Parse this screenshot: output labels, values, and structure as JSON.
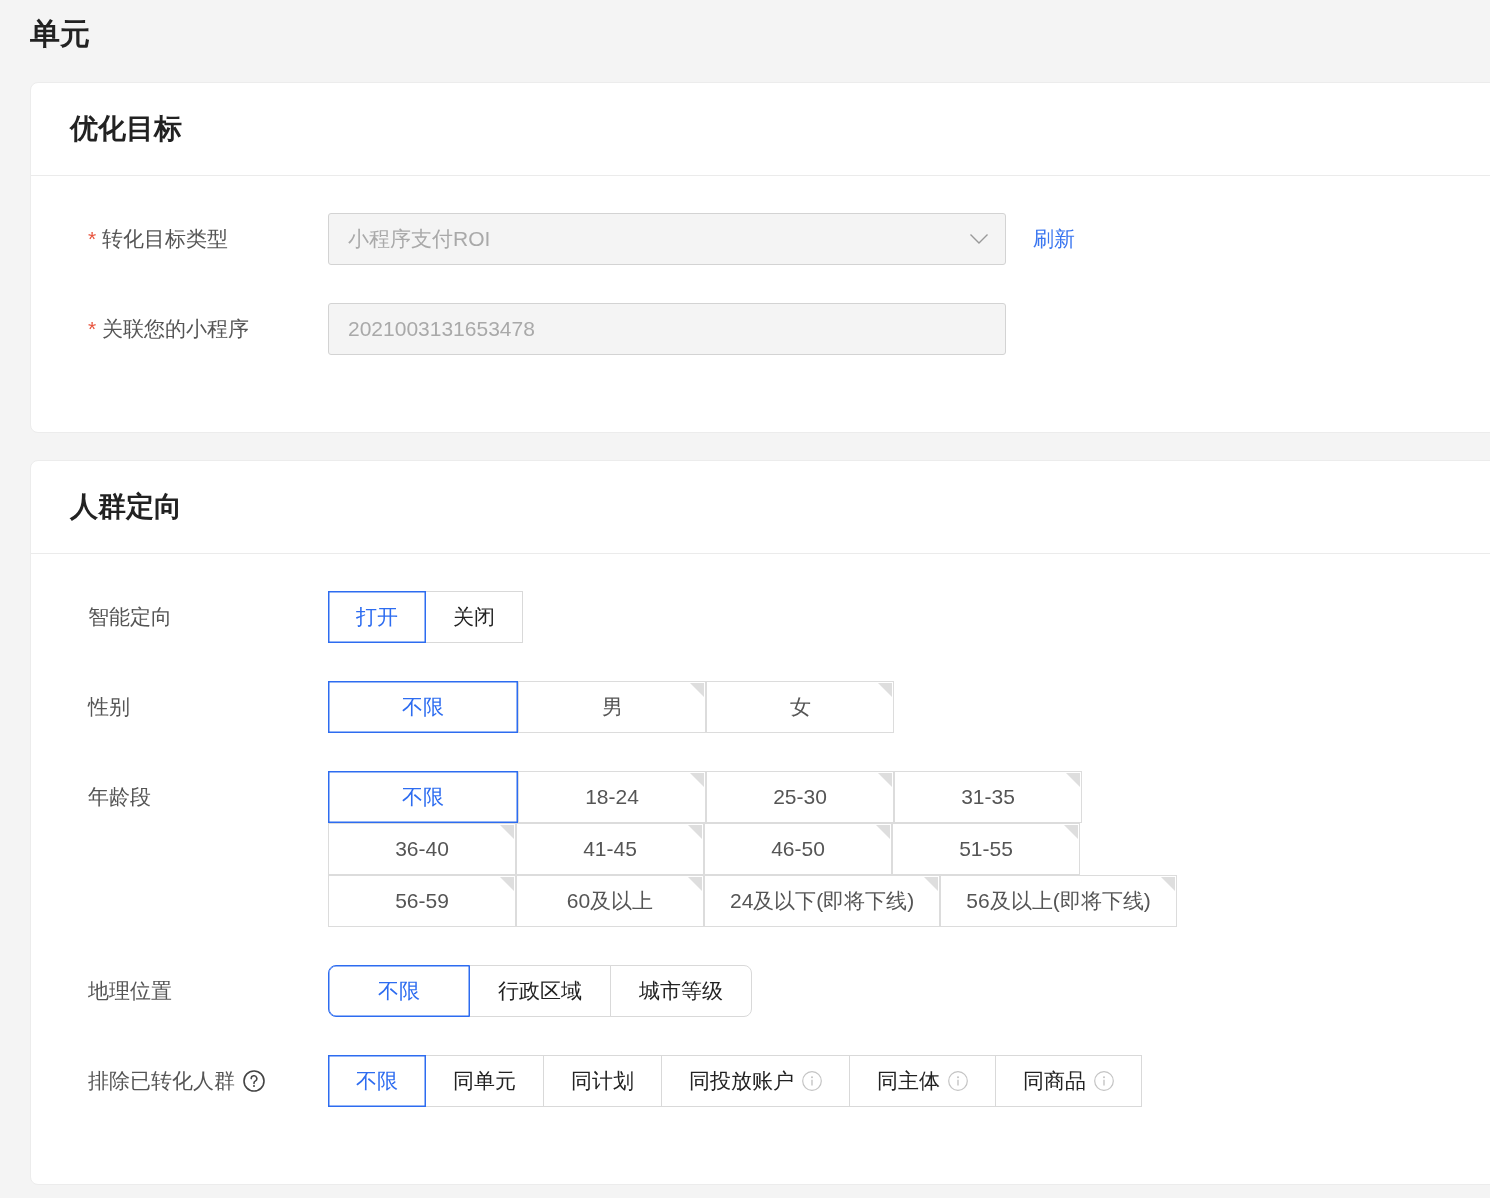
{
  "page_title": "单元",
  "sections": [
    {
      "title": "优化目标",
      "fields": [
        {
          "kind": "select",
          "required_mark": "*",
          "label": "转化目标类型",
          "value": "小程序支付ROI",
          "disabled": true,
          "link": "刷新"
        },
        {
          "kind": "input",
          "required_mark": "*",
          "label": "关联您的小程序",
          "value": "2021003131653478",
          "disabled": true
        }
      ]
    },
    {
      "title": "人群定向",
      "fields": [
        {
          "kind": "buttons",
          "label": "智能定向",
          "options": [
            {
              "label": "打开",
              "selected": true
            },
            {
              "label": "关闭",
              "selected": false
            }
          ]
        },
        {
          "kind": "tiles",
          "label": "性别",
          "options": [
            {
              "label": "不限",
              "selected": true
            },
            {
              "label": "男",
              "selected": false
            },
            {
              "label": "女",
              "selected": false
            }
          ]
        },
        {
          "kind": "tiles",
          "label": "年龄段",
          "options": [
            {
              "label": "不限",
              "selected": true
            },
            {
              "label": "18-24",
              "selected": false
            },
            {
              "label": "25-30",
              "selected": false
            },
            {
              "label": "31-35",
              "selected": false
            },
            {
              "label": "36-40",
              "selected": false
            },
            {
              "label": "41-45",
              "selected": false
            },
            {
              "label": "46-50",
              "selected": false
            },
            {
              "label": "51-55",
              "selected": false
            },
            {
              "label": "56-59",
              "selected": false
            },
            {
              "label": "60及以上",
              "selected": false
            },
            {
              "label": "24及以下(即将下线)",
              "selected": false
            },
            {
              "label": "56及以上(即将下线)",
              "selected": false
            }
          ]
        },
        {
          "kind": "rounded",
          "label": "地理位置",
          "options": [
            {
              "label": "不限",
              "selected": true
            },
            {
              "label": "行政区域",
              "selected": false
            },
            {
              "label": "城市等级",
              "selected": false
            }
          ]
        },
        {
          "kind": "buttons",
          "label": "排除已转化人群",
          "help": true,
          "options": [
            {
              "label": "不限",
              "selected": true,
              "info": false
            },
            {
              "label": "同单元",
              "selected": false,
              "info": false
            },
            {
              "label": "同计划",
              "selected": false,
              "info": false
            },
            {
              "label": "同投放账户",
              "selected": false,
              "info": true
            },
            {
              "label": "同主体",
              "selected": false,
              "info": true
            },
            {
              "label": "同商品",
              "selected": false,
              "info": true
            }
          ]
        }
      ]
    }
  ]
}
